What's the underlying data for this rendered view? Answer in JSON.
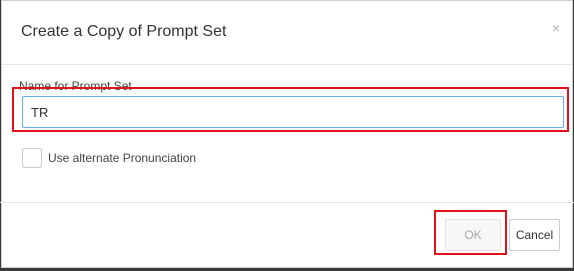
{
  "dialog": {
    "title": "Create a Copy of Prompt Set",
    "close_icon": "close-icon",
    "close_glyph": "×"
  },
  "form": {
    "name_label": "Name for Prompt Set",
    "name_value": "TR",
    "alternate_pronunciation_label": "Use alternate Pronunciation",
    "alternate_pronunciation_checked": false
  },
  "footer": {
    "ok_label": "OK",
    "ok_disabled": true,
    "cancel_label": "Cancel"
  },
  "colors": {
    "highlight": "#e0111b",
    "input_focus_border": "#66afe9"
  }
}
